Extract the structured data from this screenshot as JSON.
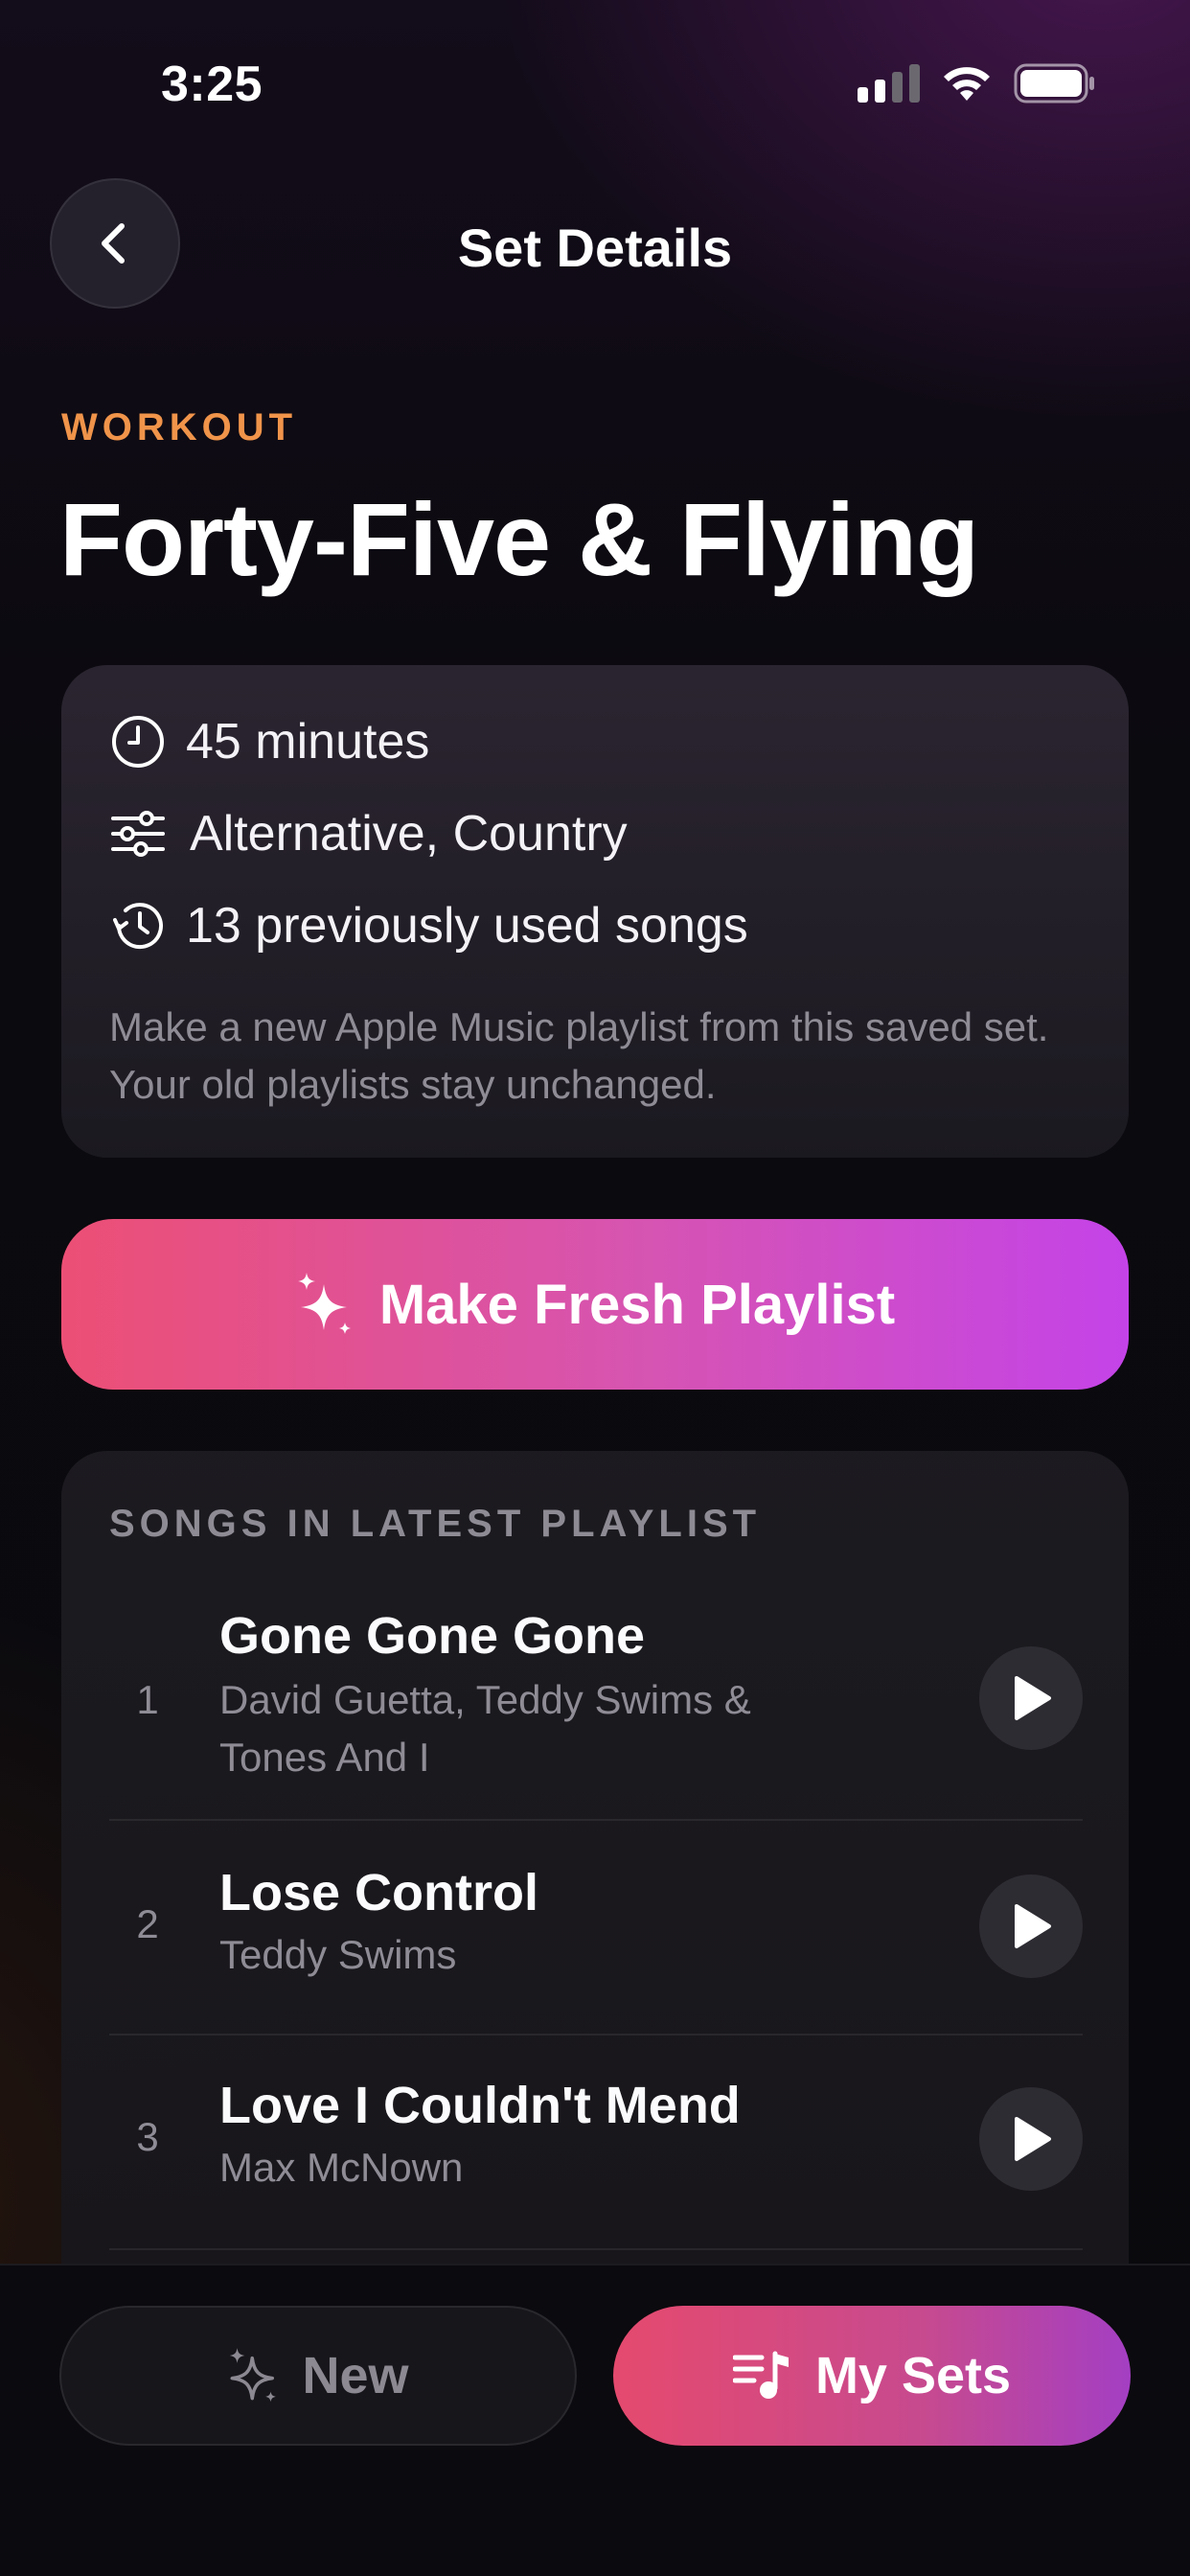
{
  "status_bar": {
    "time": "3:25",
    "signal_bars_active": 2,
    "signal_bars_total": 4,
    "icons": [
      "signal-icon",
      "wifi-icon",
      "battery-icon"
    ]
  },
  "header": {
    "title": "Set Details",
    "back_icon": "chevron-left-icon"
  },
  "set": {
    "category": "WORKOUT",
    "title": "Forty-Five & Flying",
    "info": [
      {
        "icon": "clock-icon",
        "text": "45 minutes"
      },
      {
        "icon": "sliders-icon",
        "text": "Alternative, Country"
      },
      {
        "icon": "history-icon",
        "text": "13 previously used songs"
      }
    ],
    "description": "Make a new Apple Music playlist from this saved set. Your old playlists stay unchanged."
  },
  "primary_action": {
    "label": "Make Fresh Playlist",
    "icon": "sparkles-icon"
  },
  "songs": {
    "heading": "SONGS IN LATEST PLAYLIST",
    "items": [
      {
        "number": "1",
        "title": "Gone Gone Gone",
        "artist": "David Guetta, Teddy Swims & Tones And I"
      },
      {
        "number": "2",
        "title": "Lose Control",
        "artist": "Teddy Swims"
      },
      {
        "number": "3",
        "title": "Love I Couldn't Mend",
        "artist": "Max McNown"
      }
    ]
  },
  "tab_bar": {
    "new_label": "New",
    "new_icon": "sparkles-icon",
    "my_sets_label": "My Sets",
    "my_sets_icon": "music-list-icon",
    "active": "My Sets"
  },
  "colors": {
    "accent_orange": "#f0944a",
    "gradient_start": "#ec4f75",
    "gradient_end": "#c443e8",
    "background": "#0a0a0d"
  }
}
